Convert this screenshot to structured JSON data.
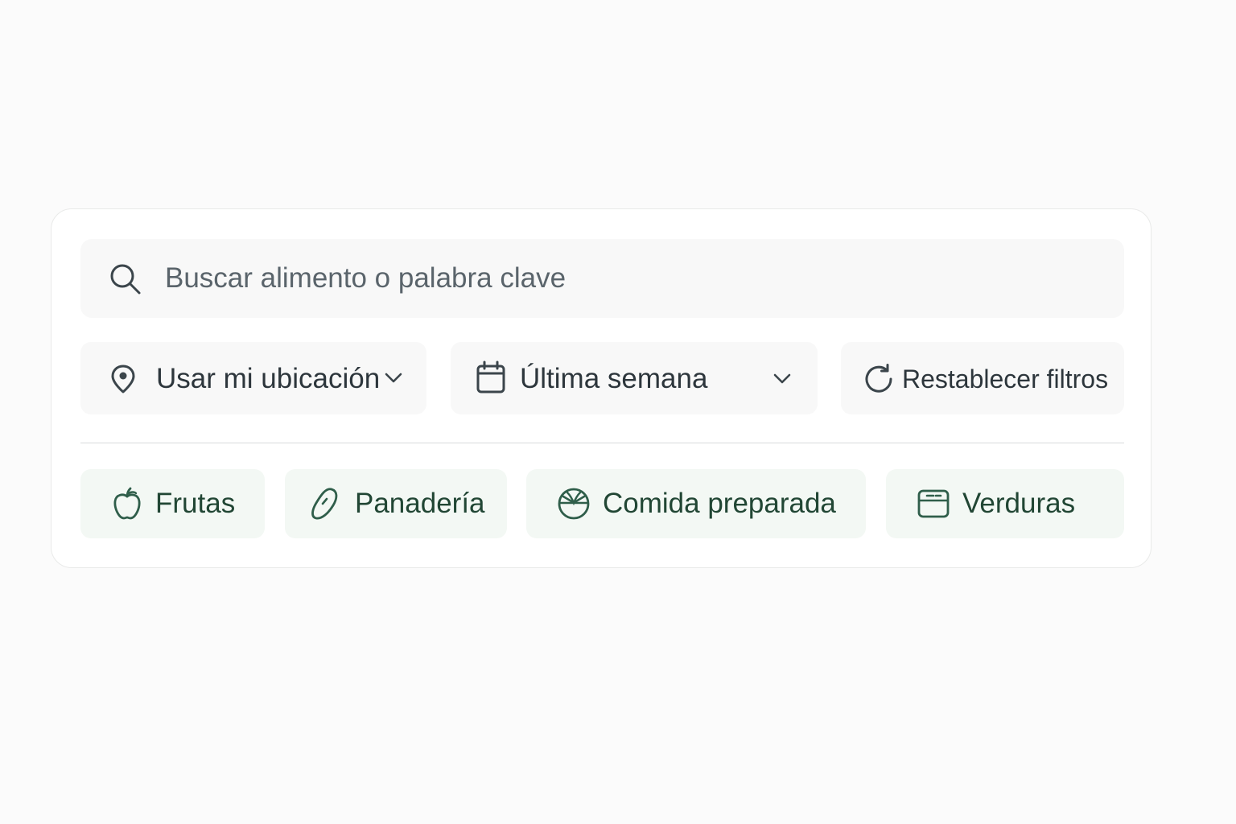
{
  "search": {
    "placeholder": "Buscar alimento o palabra clave",
    "icon": "search-icon"
  },
  "filters": {
    "location": {
      "label": "Usar mi ubicación",
      "icon": "location-pin-icon"
    },
    "date": {
      "label": "Última semana",
      "icon": "calendar-icon"
    },
    "reset": {
      "label": "Restablecer filtros",
      "icon": "refresh-icon"
    }
  },
  "categories": [
    {
      "label": "Frutas",
      "icon": "apple-icon"
    },
    {
      "label": "Panadería",
      "icon": "bread-icon"
    },
    {
      "label": "Comida preparada",
      "icon": "bowl-icon"
    },
    {
      "label": "Verduras",
      "icon": "crate-icon"
    }
  ],
  "colors": {
    "accent": "#2f5e4a",
    "chip_background": "#f3f8f4",
    "field_background": "#f8f8f8",
    "page_background": "#fbfbfb"
  }
}
